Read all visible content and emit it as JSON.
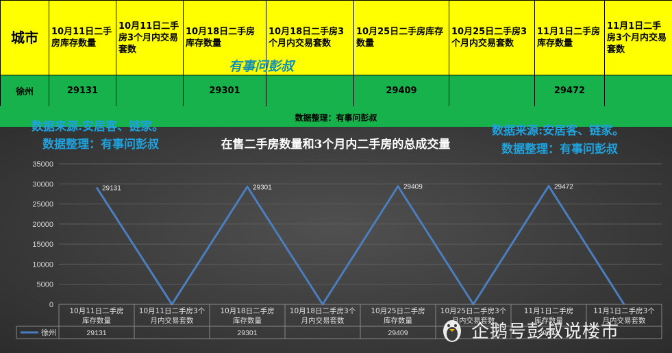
{
  "table": {
    "city_header": "城市",
    "headers": [
      "10月11日二手房库存数量",
      "10月11日二手房3个月内交易套数",
      "10月18日二手房库存数量",
      "10月18日二手房3个月内交易套数",
      "10月25日二手房库存数量",
      "10月25日二手房3个月内交易套数",
      "11月1日二手房库存数量",
      "11月1日二手房3个月内交易套数"
    ],
    "row": {
      "city": "徐州",
      "cells": [
        "29131",
        "",
        "29301",
        "",
        "29409",
        "",
        "29472",
        ""
      ]
    }
  },
  "band_text": "数据整理：有事问彭叔",
  "watermarks": {
    "source_left": "数据来源:安居客、链家。",
    "compiler_left": "数据整理：有事问彭叔",
    "source_right": "数据来源:安居客、链家。",
    "compiler_right": "数据整理：有事问彭叔",
    "teal": "有事问彭叔",
    "corner": "企鹅号彭叔说楼市"
  },
  "colors": {
    "header_yellow": "#ffff00",
    "row_green": "#17b24b",
    "line_blue": "#4a7ebf",
    "watermark_blue": "#1ea3df"
  },
  "chart_data": {
    "type": "line",
    "title": "在售二手房数量和3个月内二手房的总成交量",
    "categories": [
      "10月11日二手房库存数量",
      "10月11日二手房3个月内交易套数",
      "10月18日二手房库存数量",
      "10月18日二手房3个月内交易套数",
      "10月25日二手房库存数量",
      "10月25日二手房3个月内交易套数",
      "11月1日二手房库存数量",
      "11月1日二手房3个月内交易套数"
    ],
    "series": [
      {
        "name": "徐州",
        "values": [
          29131,
          0,
          29301,
          0,
          29409,
          0,
          29472,
          0
        ]
      }
    ],
    "data_labels": [
      "29131",
      "",
      "29301",
      "",
      "29409",
      "",
      "29472",
      ""
    ],
    "y_ticks": [
      0,
      5000,
      10000,
      15000,
      20000,
      25000,
      30000,
      35000
    ],
    "ylim": [
      0,
      35000
    ],
    "grid": true,
    "legend": "data-table-bottom"
  }
}
